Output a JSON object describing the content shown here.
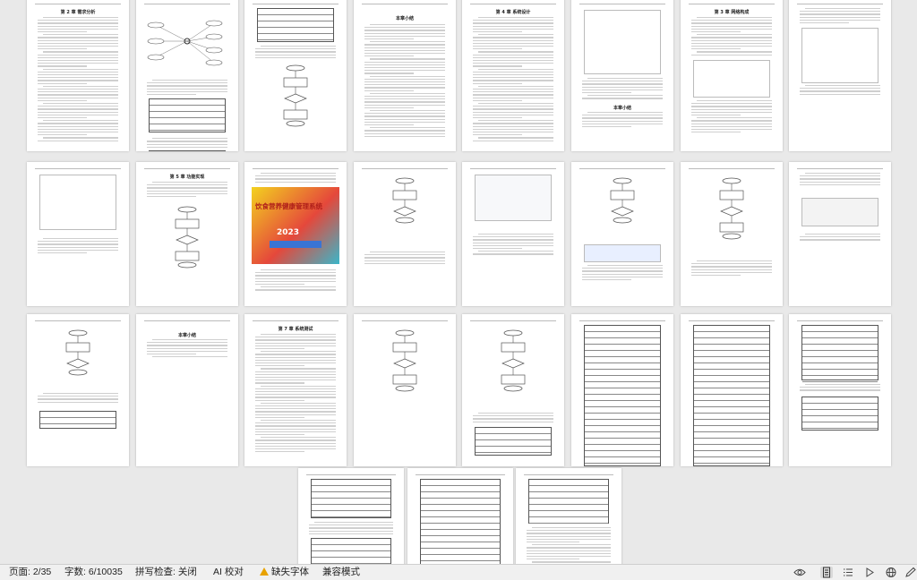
{
  "status_bar": {
    "page": "页面: 2/35",
    "words": "字数: 6/10035",
    "spell": "拼写检查: 关闭",
    "ai": "AI 校对",
    "missing_font": "缺失字体",
    "compat": "兼容模式"
  },
  "view_icons": [
    "eye-icon",
    "page-view-icon",
    "outline-view-icon",
    "play-icon",
    "web-view-icon",
    "pen-icon"
  ],
  "pages": {
    "heading_ch2": "第 2 章  需求分析",
    "heading_ch4": "第 4 章  系统设计",
    "heading_ch3": "第 3 章  网络构成",
    "heading_ch5": "第 5 章  功能实现",
    "heading_ch7": "第 7 章  系统测试",
    "heading_summary": "本章小结",
    "cover_title": "饮食营养健康管理系统",
    "cover_year": "2023"
  },
  "colors": {
    "workspace": "#e9e9e9",
    "statusbar": "#f0f0f0",
    "warning": "#e8a200",
    "cover_yellow": "#f3d21f",
    "cover_red": "#e5483b",
    "cover_teal": "#3bb6c9"
  }
}
